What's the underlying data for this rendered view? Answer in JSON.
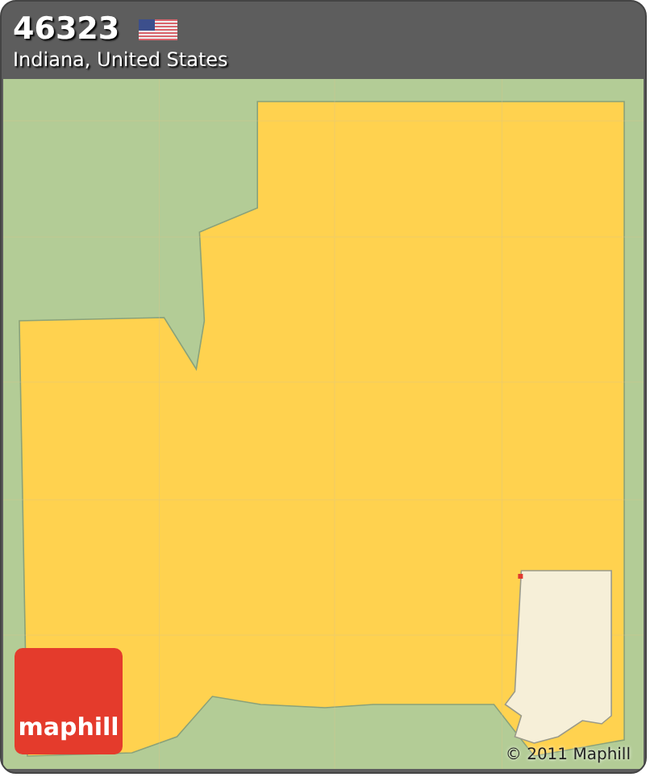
{
  "header": {
    "title": "46323",
    "subtitle": "Indiana, United States"
  },
  "logo": {
    "text": "maphill"
  },
  "copyright": "© 2011 Maphill"
}
